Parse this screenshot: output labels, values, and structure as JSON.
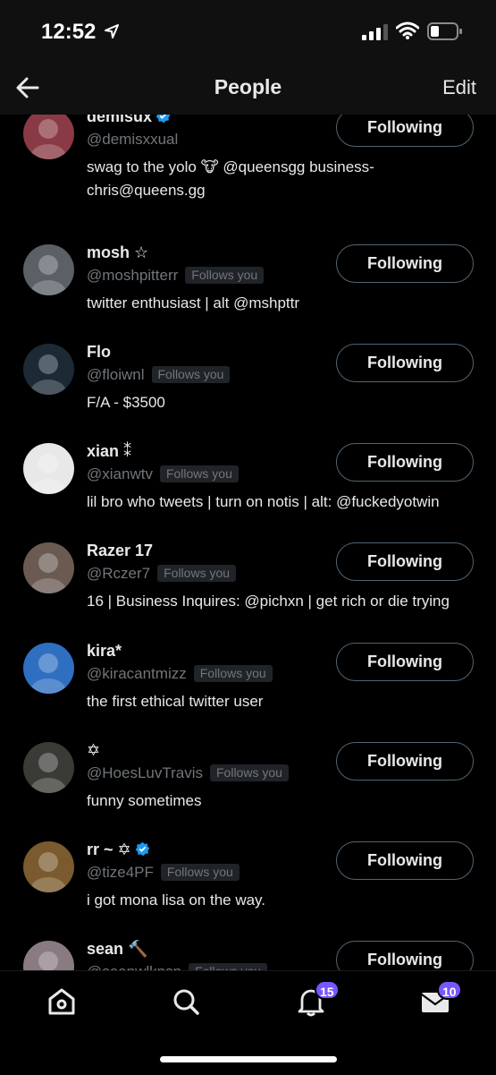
{
  "status": {
    "time": "12:52"
  },
  "nav": {
    "title": "People",
    "edit": "Edit"
  },
  "people": [
    {
      "name": "demisux",
      "symbol": "",
      "verified": true,
      "handle": "@demisxxual",
      "follows_you": false,
      "bio": [
        "swag to the yolo 🐮 @queensgg business-",
        "chris@queens.gg"
      ],
      "button": "Following",
      "avatar_color": "#8a3a44"
    },
    {
      "name": "mosh",
      "symbol": "☆",
      "verified": false,
      "handle": "@moshpitterr",
      "follows_you": true,
      "bio": [
        "twitter enthusiast | alt @mshpttr"
      ],
      "button": "Following",
      "avatar_color": "#5b5f66"
    },
    {
      "name": "Flo",
      "symbol": "",
      "verified": false,
      "handle": "@floiwnl",
      "follows_you": true,
      "bio": [
        "F/A - $3500"
      ],
      "button": "Following",
      "avatar_color": "#1c2a36"
    },
    {
      "name": "xian",
      "symbol": "⁑",
      "verified": false,
      "handle": "@xianwtv",
      "follows_you": true,
      "bio": [
        "lil bro who tweets | turn on notis | alt: @fuckedyotwin"
      ],
      "button": "Following",
      "avatar_color": "#e8e8e8"
    },
    {
      "name": "Razer 17",
      "symbol": "",
      "verified": false,
      "handle": "@Rczer7",
      "follows_you": true,
      "bio": [
        "16 | Business Inquires: @pichxn | get rich or die trying"
      ],
      "button": "Following",
      "avatar_color": "#6b5a52"
    },
    {
      "name": "kira*",
      "symbol": "",
      "verified": false,
      "handle": "@kiracantmizz",
      "follows_you": true,
      "bio": [
        "the first ethical twitter user"
      ],
      "button": "Following",
      "avatar_color": "#2e6fc2"
    },
    {
      "name": "",
      "symbol": "✡",
      "verified": false,
      "handle": "@HoesLuvTravis",
      "follows_you": true,
      "bio": [
        "funny sometimes"
      ],
      "button": "Following",
      "avatar_color": "#3a3a36"
    },
    {
      "name": "rr ~",
      "symbol": "✡",
      "verified": true,
      "handle": "@tize4PF",
      "follows_you": true,
      "bio": [
        "i got mona lisa on the way."
      ],
      "button": "Following",
      "avatar_color": "#7a5a2e"
    },
    {
      "name": "sean",
      "symbol": "🔨",
      "verified": false,
      "handle": "@seanwlknsn",
      "follows_you": true,
      "bio": [],
      "button": "Following",
      "avatar_color": "#8a7a82"
    }
  ],
  "follows_you_label": "Follows you",
  "tabbar": {
    "notifications_badge": "15",
    "messages_badge": "10"
  },
  "colors": {
    "accent": "#1d9bf0",
    "badge": "#7856ff",
    "muted": "#71767b"
  }
}
